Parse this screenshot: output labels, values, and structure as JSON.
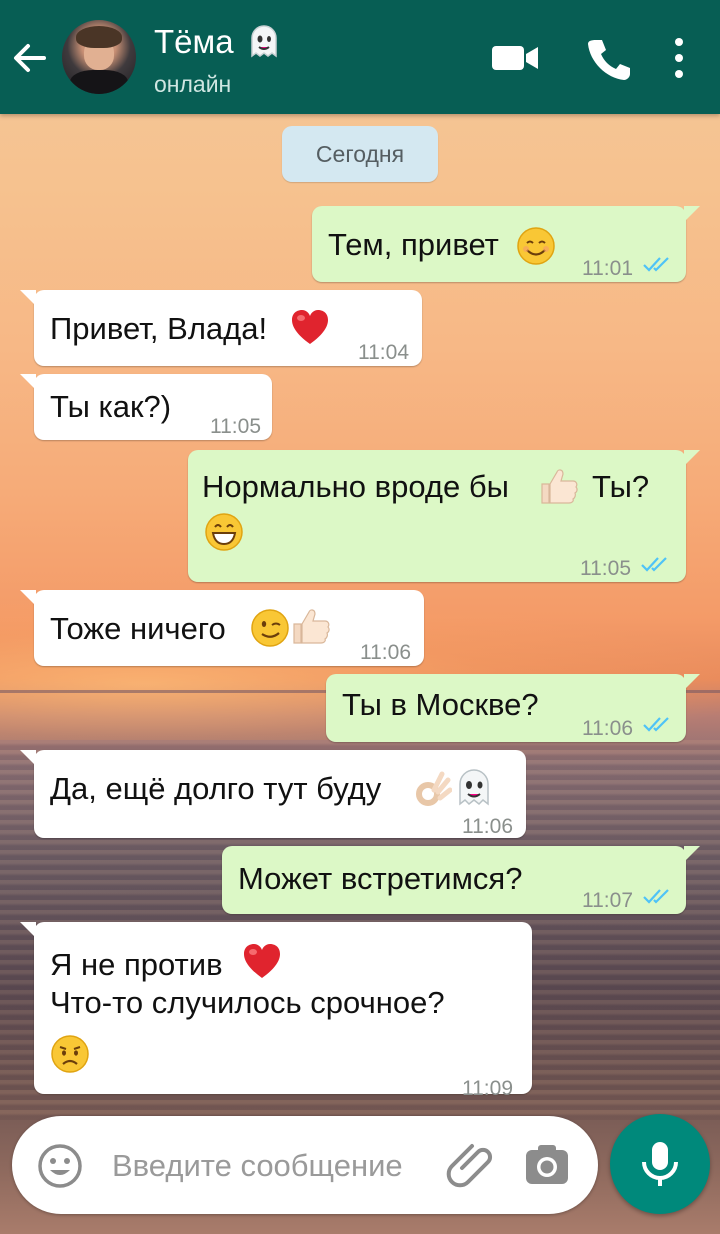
{
  "header": {
    "contact_name": "Тёма",
    "status": "онлайн"
  },
  "date_chip": "Сегодня",
  "messages": [
    {
      "dir": "out",
      "text": "Тем, привет",
      "time": "11:01",
      "read": true
    },
    {
      "dir": "in",
      "text": "Привет, Влада!",
      "time": "11:04"
    },
    {
      "dir": "in",
      "text": "Ты как?)",
      "time": "11:05"
    },
    {
      "dir": "out",
      "text": "Нормально вроде бы",
      "text_b": "Ты?",
      "time": "11:05",
      "read": true
    },
    {
      "dir": "in",
      "text": "Тоже ничего",
      "time": "11:06"
    },
    {
      "dir": "out",
      "text": "Ты в Москве?",
      "time": "11:06",
      "read": true
    },
    {
      "dir": "in",
      "text": "Да, ещё долго тут буду",
      "time": "11:06"
    },
    {
      "dir": "out",
      "text": "Может встретимся?",
      "time": "11:07",
      "read": true
    },
    {
      "dir": "in",
      "text": "Я не против",
      "text_b": "Что-то случилось срочное?",
      "time": "11:09"
    }
  ],
  "composer": {
    "placeholder": "Введите сообщение"
  },
  "colors": {
    "header": "#075e54",
    "outgoing_bubble": "#dcf8c6",
    "incoming_bubble": "#ffffff",
    "read_ticks": "#4fc3f7",
    "mic_button": "#00897b"
  },
  "icons": {
    "back": "arrow-left-icon",
    "video": "video-camera-icon",
    "call": "phone-icon",
    "menu": "more-vertical-icon",
    "emoji": "smiley-icon",
    "attach": "paperclip-icon",
    "camera": "camera-icon",
    "mic": "microphone-icon"
  }
}
